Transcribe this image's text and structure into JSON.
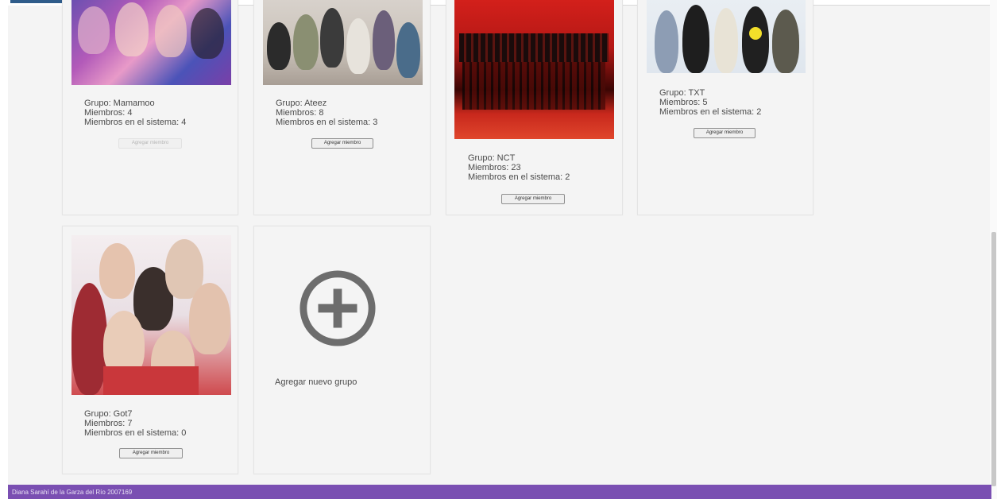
{
  "groups": [
    {
      "group_line": "Grupo: Mamamoo",
      "members_line": "Miembros: 4",
      "system_line": "Miembros en el sistema: 4",
      "button_label": "Agregar miembro",
      "button_disabled": true
    },
    {
      "group_line": "Grupo: Ateez",
      "members_line": "Miembros: 8",
      "system_line": "Miembros en el sistema: 3",
      "button_label": "Agregar miembro",
      "button_disabled": false
    },
    {
      "group_line": "Grupo: NCT",
      "members_line": "Miembros: 23",
      "system_line": "Miembros en el sistema: 2",
      "button_label": "Agregar miembro",
      "button_disabled": false
    },
    {
      "group_line": "Grupo: TXT",
      "members_line": "Miembros: 5",
      "system_line": "Miembros en el sistema: 2",
      "button_label": "Agregar miembro",
      "button_disabled": false
    },
    {
      "group_line": "Grupo: Got7",
      "members_line": "Miembros: 7",
      "system_line": "Miembros en el sistema: 0",
      "button_label": "Agregar miembro",
      "button_disabled": false
    }
  ],
  "add_group": {
    "label": "Agregar nuevo grupo",
    "icon": "plus-circle-icon"
  },
  "footer": {
    "text": "Diana Sarahí de la Garza del Río 2007169"
  },
  "colors": {
    "footer_bg": "#7a4fb2",
    "card_bg": "#f4f4f4",
    "icon_gray": "#6d6d6d"
  }
}
